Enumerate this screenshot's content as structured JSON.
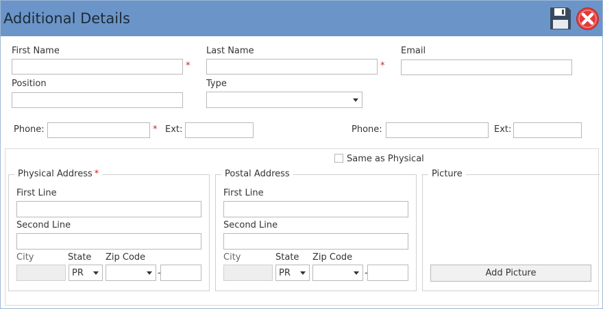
{
  "window": {
    "title": "Additional Details"
  },
  "form": {
    "first_name": {
      "label": "First Name",
      "value": "",
      "required": "*"
    },
    "last_name": {
      "label": "Last Name",
      "value": "",
      "required": "*"
    },
    "email": {
      "label": "Email",
      "value": ""
    },
    "position": {
      "label": "Position",
      "value": ""
    },
    "type": {
      "label": "Type",
      "value": ""
    },
    "phone1": {
      "label": "Phone:",
      "value": "",
      "required": "*",
      "ext_label": "Ext:",
      "ext_value": ""
    },
    "phone2": {
      "label": "Phone:",
      "value": "",
      "ext_label": "Ext:",
      "ext_value": ""
    }
  },
  "same_as_physical": {
    "label": "Same as Physical",
    "checked": false
  },
  "physical_address": {
    "title": "Physical Address",
    "required": "*",
    "first_line_label": "First Line",
    "second_line_label": "Second Line",
    "city_label": "City",
    "state_label": "State",
    "zip_label": "Zip Code",
    "state_value": "PR",
    "zip_separator": "-"
  },
  "postal_address": {
    "title": "Postal Address",
    "first_line_label": "First Line",
    "second_line_label": "Second Line",
    "city_label": "City",
    "state_label": "State",
    "zip_label": "Zip Code",
    "state_value": "PR",
    "zip_separator": "-"
  },
  "picture": {
    "title": "Picture",
    "add_button_label": "Add Picture"
  },
  "colors": {
    "titlebar": "#6b95c8",
    "required": "#d21f1f",
    "close_red": "#e23b3b",
    "save_icon": "#3a4a5e"
  }
}
